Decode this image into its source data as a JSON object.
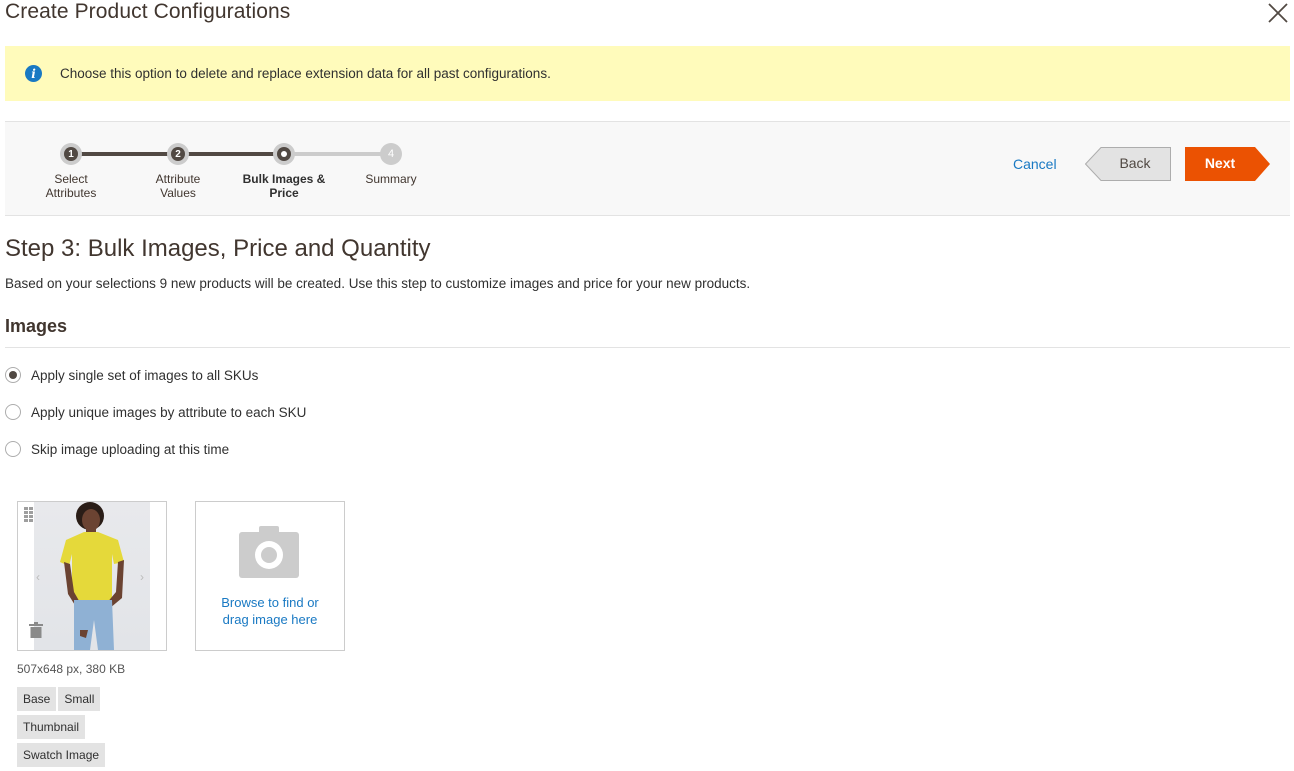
{
  "modal": {
    "title": "Create Product Configurations",
    "close_icon": "close-icon"
  },
  "notice": {
    "icon": "info-icon",
    "icon_glyph": "i",
    "text": "Choose this option to delete and replace extension data for all past configurations."
  },
  "wizard": {
    "steps": [
      {
        "number": "1",
        "label_line1": "Select",
        "label_line2": "Attributes",
        "state": "completed"
      },
      {
        "number": "2",
        "label_line1": "Attribute",
        "label_line2": "Values",
        "state": "completed"
      },
      {
        "number": "3",
        "label_line1": "Bulk Images &",
        "label_line2": "Price",
        "state": "current"
      },
      {
        "number": "4",
        "label_line1": "Summary",
        "label_line2": "",
        "state": "pending"
      }
    ],
    "cancel_label": "Cancel",
    "back_label": "Back",
    "next_label": "Next"
  },
  "content": {
    "step_title": "Step 3: Bulk Images, Price and Quantity",
    "description": "Based on your selections 9 new products will be created. Use this step to customize images and price for your new products.",
    "images_section_title": "Images",
    "image_options": [
      {
        "label": "Apply single set of images to all SKUs",
        "checked": true
      },
      {
        "label": "Apply unique images by attribute to each SKU",
        "checked": false
      },
      {
        "label": "Skip image uploading at this time",
        "checked": false
      }
    ],
    "image": {
      "alt": "Woman in yellow t-shirt and ripped jeans",
      "meta": "507x648 px, 380 KB",
      "roles": [
        "Base",
        "Small",
        "Thumbnail",
        "Swatch Image"
      ]
    },
    "upload": {
      "line1": "Browse to find or",
      "line2": "drag image here"
    }
  },
  "colors": {
    "accent_blue": "#1979c3",
    "next_orange": "#eb5202",
    "notice_yellow": "#fffbbb",
    "step_dark": "#514943"
  }
}
